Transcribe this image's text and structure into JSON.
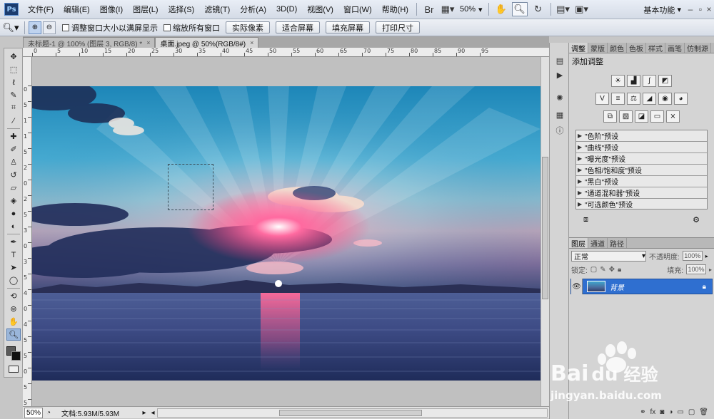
{
  "app": {
    "logo_text": "Ps"
  },
  "menu": [
    "文件(F)",
    "编辑(E)",
    "图像(I)",
    "图层(L)",
    "选择(S)",
    "滤镜(T)",
    "分析(A)",
    "3D(D)",
    "视图(V)",
    "窗口(W)",
    "帮助(H)"
  ],
  "menubar": {
    "zoom": "50%",
    "workspace": "基本功能"
  },
  "options": {
    "resize_windows_label": "调整窗口大小以满屏显示",
    "zoom_all_windows_label": "缩放所有窗口",
    "actual_pixels": "实际像素",
    "fit_screen": "适合屏幕",
    "fill_screen": "填充屏幕",
    "print_size": "打印尺寸"
  },
  "tabs": [
    {
      "title": "未标题-1 @ 100% (图层 3, RGB/8) *",
      "close": "×",
      "active": false
    },
    {
      "title": "桌面.jpeg @ 50%(RGB/8#)",
      "close": "×",
      "active": true
    }
  ],
  "ruler_top": [
    "0",
    "5",
    "10",
    "15",
    "20",
    "25",
    "30",
    "35",
    "40",
    "45",
    "50",
    "55",
    "60",
    "65",
    "70",
    "75",
    "80",
    "85",
    "90",
    "95"
  ],
  "ruler_left": [
    "0",
    "5",
    "1",
    "1",
    "5",
    "2",
    "0",
    "2",
    "5",
    "3",
    "0",
    "3",
    "5",
    "4",
    "0",
    "4",
    "5",
    "5",
    "0",
    "5",
    "5"
  ],
  "status": {
    "zoom": "50%",
    "doc_info": "文档:5.93M/5.93M"
  },
  "panels": {
    "adjust_tabs": [
      "调整",
      "蒙版",
      "颜色",
      "色板",
      "样式",
      "画笔",
      "仿制源"
    ],
    "adjust_title": "添加调整",
    "presets": [
      "\"色阶\"预设",
      "\"曲线\"预设",
      "\"曝光度\"预设",
      "\"色相/饱和度\"预设",
      "\"黑白\"预设",
      "\"通道混和器\"预设",
      "\"可选颜色\"预设"
    ],
    "layers_tabs": [
      "图层",
      "通道",
      "路径"
    ],
    "blend_mode": "正常",
    "opacity_label": "不透明度:",
    "opacity_value": "100%",
    "lock_label": "锁定:",
    "fill_label": "填充:",
    "fill_value": "100%",
    "layer_name": "背景"
  },
  "watermark": {
    "brand": "Bai",
    "brand_cn": "经验",
    "url": "jingyan.baidu.com"
  },
  "colors": {
    "accent": "#2f6fd0",
    "menubar": "#dde3ec",
    "canvas_bg": "#c0c0c0"
  }
}
